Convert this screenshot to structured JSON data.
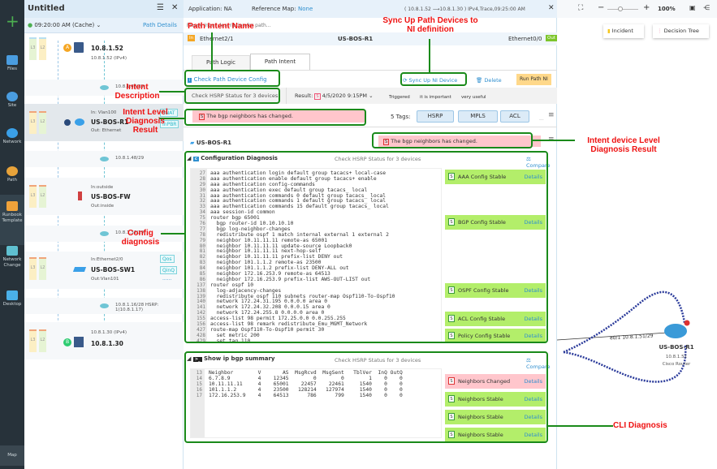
{
  "rail": {
    "items": [
      {
        "label": "Files"
      },
      {
        "label": "Site"
      },
      {
        "label": "Network"
      },
      {
        "label": "Path"
      },
      {
        "label": "Runbook Template"
      },
      {
        "label": "Network Change"
      },
      {
        "label": "Desktop"
      }
    ],
    "bottom": "Map",
    "add": "+"
  },
  "path_panel": {
    "title": "Untitled",
    "time": "09:20:00 AM (Cache)",
    "details_link": "Path Details",
    "rows": [
      {
        "type": "device",
        "badge": "A",
        "name": "10.8.1.52",
        "sub": "10.8.1.52 (IPv4)"
      },
      {
        "type": "subnet",
        "label": "10.8.1.48/29"
      },
      {
        "type": "device",
        "in": "In: Vlan100",
        "name": "US-BOS-R1",
        "out": "Out: Ethernet",
        "tags": [
          "SNAT",
          "InPBR"
        ]
      },
      {
        "type": "subnet",
        "label": "10.8.1.48/29"
      },
      {
        "type": "device",
        "in": "In:outside",
        "name": "US-BOS-FW",
        "out": "Out:inside"
      },
      {
        "type": "subnet",
        "label": "10.8.1.32/29"
      },
      {
        "type": "device",
        "in": "In:Ethernet2/0",
        "name": "US-BOS-SW1",
        "out": "Out:Vlan101",
        "tags": [
          "Qos",
          "QinQ"
        ],
        "more": "......"
      },
      {
        "type": "subnet",
        "label": "10.8.1.16/28 HSRP: 1(10.8.1.17)"
      },
      {
        "type": "device",
        "badge": "B",
        "name": "10.8.1.30",
        "sub": "10.8.1.30 (IPv4)"
      }
    ],
    "layers": [
      "L3",
      "L2"
    ]
  },
  "main": {
    "application": "Application: NA",
    "refmap_label": "Reference Map:",
    "refmap_value": "None",
    "path_info": "( 10.8.1.52  ⟶10.8.1.30 ) IPv4,Trace,09:25:00 AM",
    "description_placeholder": "Please input description for path...",
    "in_badge": "In",
    "in_intf": "Ethernet2/1",
    "device": "US-BOS-R1",
    "out_intf": "Ethernet0/0",
    "out_badge": "Out",
    "tabs": [
      {
        "label": "Path Logic"
      },
      {
        "label": "Path Intent"
      }
    ],
    "intent_name": "Check Path Device Config",
    "sync": "Sync Up NI Device",
    "delete": "Delete",
    "run": "Run Path NI",
    "intent_desc": "Check HSRP Status for 3 devices",
    "result_label": "Result:",
    "result_date": "4/5/2020 9:15PM",
    "flags": [
      "Triggered",
      "it is important",
      "very useful"
    ],
    "intent_result": "The bgp neighbors has changed.",
    "tags_label": "5 Tags:",
    "tags": [
      "HSRP",
      "MPLS",
      "ACL"
    ],
    "tags_more": "...",
    "device_section": "US-BOS-R1",
    "device_result": "The bgp neighbors has changed.",
    "config": {
      "title": "Configuration Diagnosis",
      "desc": "Check HSRP Status for 3 devices",
      "compare": "Compare",
      "lines": [
        [
          "27",
          "aaa authentication login default group tacacs+ local-case"
        ],
        [
          "28",
          "aaa authentication enable default group tacacs+ enable"
        ],
        [
          "29",
          "aaa authentication config-commands"
        ],
        [
          "30",
          "aaa authentication exec default group tacacs_ local"
        ],
        [
          "31",
          "aaa authentication commands 0 default group tacacs_ local"
        ],
        [
          "32",
          "aaa authentication commands 1 default group tacacs_ local"
        ],
        [
          "33",
          "aaa authentication commands 15 default group tacacs_ local"
        ],
        [
          "34",
          "aaa session-id common"
        ],
        [
          "75",
          "router bgp 65001"
        ],
        [
          "76",
          "  bgp router-id 10.10.10.10"
        ],
        [
          "77",
          "  bgp log-neighbor-changes"
        ],
        [
          "78",
          "  redistribute ospf 1 match internal external 1 external 2"
        ],
        [
          "79",
          "  neighbor 10.11.11.11 remote-as 65001"
        ],
        [
          "80",
          "  neighbor 10.11.11.11 update-source Loopback0"
        ],
        [
          "81",
          "  neighbor 10.11.11.11 next-hop-self"
        ],
        [
          "82",
          "  neighbor 10.11.11.11 prefix-list DENY out"
        ],
        [
          "83",
          "  neighbor 101.1.1.2 remote-as 23500"
        ],
        [
          "84",
          "  neighbor 101.1.1.2 prefix-list DENY-ALL out"
        ],
        [
          "85",
          "  neighbor 172.16.253.9 remote-as 64513"
        ],
        [
          "86",
          "  neighbor 172.16.253.9 prefix-list AWS-OUT-LIST out"
        ],
        [
          "137",
          "router ospf 10"
        ],
        [
          "138",
          "  log-adjacency-changes"
        ],
        [
          "139",
          "  redistribute ospf 110 subnets router-map Ospf110-To-Ospf10"
        ],
        [
          "140",
          "  network 172.24.31.195 0.0.0.0 area 0"
        ],
        [
          "141",
          "  network 172.24.32.208 0.0.0.15 area 0"
        ],
        [
          "142",
          "  network 172.24.255.8 0.0.0.0 area 0"
        ],
        [
          "155",
          "access-list 98 permit 172.25.0.0 0.0.255.255"
        ],
        [
          "156",
          "access-list 98 remark redistribute_Emu_MGMT_Network"
        ],
        [
          "427",
          "route-map Ospf110-To-Ospf10 permit 30"
        ],
        [
          "428",
          "  set metric 200"
        ],
        [
          "429",
          "  set tag 110"
        ]
      ],
      "results": [
        {
          "label": "AAA Config Stable",
          "details": "Details",
          "status": "S"
        },
        {
          "label": "BGP Config Stable",
          "details": "Details",
          "status": "S"
        },
        {
          "label": "OSPF Config Stable",
          "details": "Details",
          "status": "S"
        },
        {
          "label": "ACL Config Stable",
          "details": "Details",
          "status": "S"
        },
        {
          "label": "Policy Config Stable",
          "details": "Details",
          "status": "S"
        }
      ]
    },
    "cli": {
      "title": "Show ip bgp summary",
      "desc": "Check HSRP Status for 3 devices",
      "compare": "Compare",
      "lines": [
        [
          "13",
          "Neighbor        V       AS  MsgRcvd  MsgSent   TblVer  InQ OutQ"
        ],
        [
          "14",
          "6.7.8.9         4    12345        0        0        1    0    0"
        ],
        [
          "15",
          "10.11.11.11     4    65001    22457    22461     1540    0    0"
        ],
        [
          "16",
          "101.1.1.2       4    23500   128214   127974     1540    0    0"
        ],
        [
          "17",
          "172.16.253.9    4    64513      786      799     1540    0    0"
        ]
      ],
      "results": [
        {
          "label": "Neighbors Changed",
          "details": "Details",
          "status": "S"
        },
        {
          "label": "Neighbors Stable",
          "details": "Details",
          "status": "S"
        },
        {
          "label": "Neighbors Stable",
          "details": "Details",
          "status": "S"
        },
        {
          "label": "Neighbors Stable",
          "details": "Details",
          "status": "S"
        }
      ]
    }
  },
  "map": {
    "zoom": "100%",
    "incident": "Incident",
    "decision_tree": "Decision Tree",
    "node_name": "US-BOS-R1",
    "node_ip": "10.8.1.51",
    "node_type": "Cisco Router",
    "link_label": "e0/1 10.8.1.51/29"
  },
  "annotations": {
    "intent_name": "Path Intent Name",
    "sync": "Sync Up Path Devices to NI definition",
    "intent_desc": "Intent Description",
    "intent_level": "Intent Level Diagnosis Result",
    "device_level": "Intent device Level Diagnosis Result",
    "config": "Config diagnosis",
    "cli": "CLI Diagnosis"
  },
  "colors": {
    "accent": "#2f8fcf",
    "annotation": "#ee1111",
    "annotation_line": "#1a8a1a",
    "stable": "#b3ee6a",
    "changed": "#ffc6cc"
  }
}
